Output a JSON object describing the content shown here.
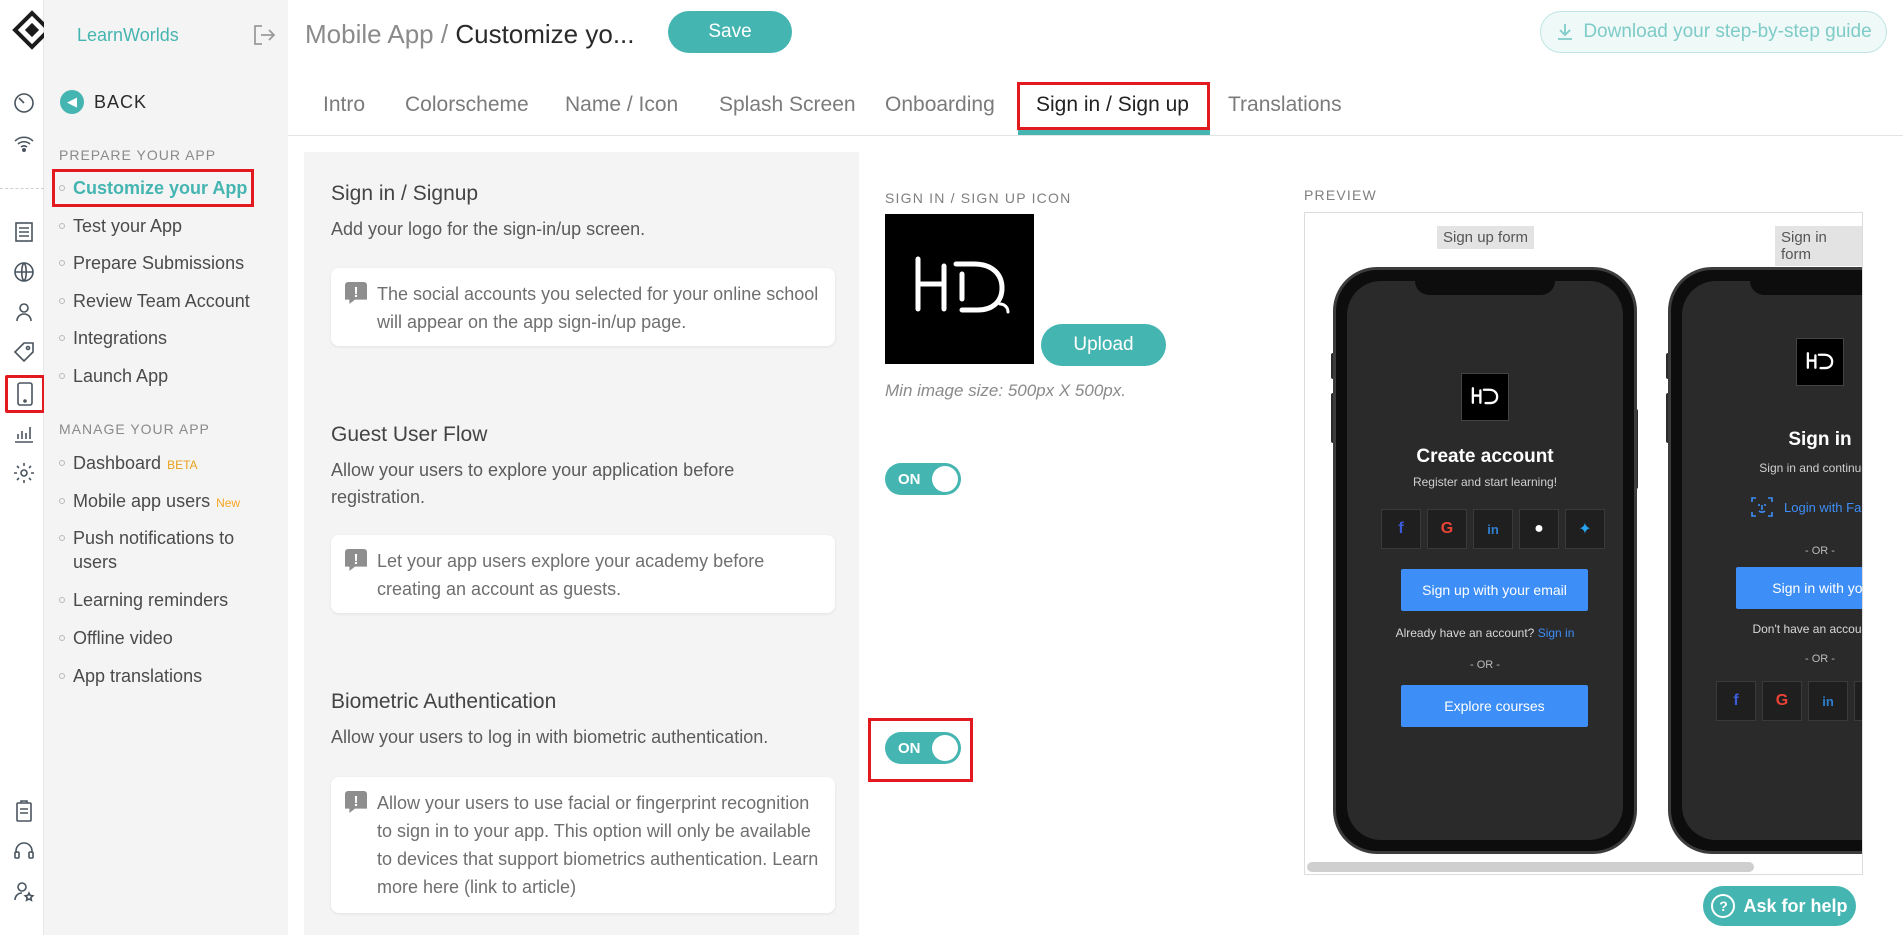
{
  "app": {
    "brand": "LearnWorlds"
  },
  "sidebar": {
    "back_label": "BACK",
    "section_prepare": "PREPARE YOUR APP",
    "prepare_items": [
      {
        "label": "Customize your App"
      },
      {
        "label": "Test your App"
      },
      {
        "label": "Prepare Submissions"
      },
      {
        "label": "Review Team Account"
      },
      {
        "label": "Integrations"
      },
      {
        "label": "Launch App"
      }
    ],
    "section_manage": "MANAGE YOUR APP",
    "manage_items": [
      {
        "label": "Dashboard",
        "badge": "BETA"
      },
      {
        "label": "Mobile app users",
        "badge": "New"
      },
      {
        "label": "Push notifications to users"
      },
      {
        "label": "Learning reminders"
      },
      {
        "label": "Offline video"
      },
      {
        "label": "App translations"
      }
    ]
  },
  "header": {
    "breadcrumb_parent": "Mobile App /",
    "breadcrumb_current": "Customize yo...",
    "save_label": "Save",
    "guide_label": "Download your step-by-step guide"
  },
  "tabs": [
    {
      "label": "Intro"
    },
    {
      "label": "Colorscheme"
    },
    {
      "label": "Name / Icon"
    },
    {
      "label": "Splash Screen"
    },
    {
      "label": "Onboarding"
    },
    {
      "label": "Sign in / Sign up",
      "active": true
    },
    {
      "label": "Translations"
    }
  ],
  "settings": {
    "signin": {
      "title": "Sign in / Signup",
      "desc": "Add your logo for the sign-in/up screen.",
      "note": "The social accounts you selected for your online school will appear on the app sign-in/up page."
    },
    "guest": {
      "title": "Guest User Flow",
      "desc": "Allow your users to explore your application before registration.",
      "note": "Let your app users explore your academy before creating an account as guests.",
      "toggle": "ON"
    },
    "biometric": {
      "title": "Biometric Authentication",
      "desc": "Allow your users to log in with biometric authentication.",
      "note": "Allow your users to use facial or fingerprint recognition to sign in to your app. This option will only be available to devices that support biometrics authentication. Learn more here (link to article)",
      "toggle": "ON"
    }
  },
  "icon_upload": {
    "label": "SIGN IN / SIGN UP ICON",
    "upload_label": "Upload",
    "min_size": "Min image size: 500px X 500px."
  },
  "preview": {
    "label": "PREVIEW",
    "signup": {
      "tag": "Sign up form",
      "title": "Create account",
      "subtitle": "Register and start learning!",
      "email_button": "Sign up with your email",
      "have_account": "Already have an account?",
      "sign_in_link": "Sign in",
      "or": "- OR -",
      "explore_button": "Explore courses"
    },
    "signin": {
      "tag": "Sign in form",
      "title": "Sign in",
      "subtitle": "Sign in and continue le",
      "faceid_label": "Login with Fa",
      "or": "- OR -",
      "email_button": "Sign in with your e",
      "no_account": "Don't have an account ye",
      "or2": "- OR -"
    }
  },
  "help": {
    "label": "Ask for help"
  },
  "colors": {
    "accent": "#45b5b1",
    "highlight": "#e2191e",
    "preview_button": "#3d8ef7"
  }
}
